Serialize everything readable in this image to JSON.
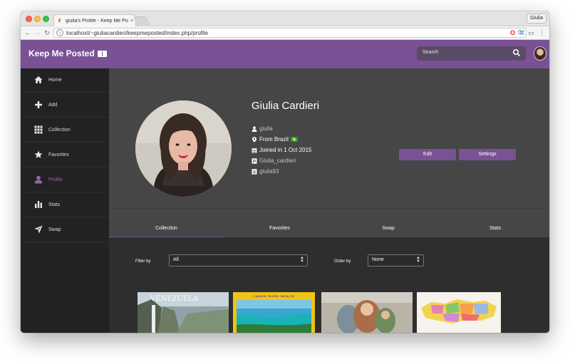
{
  "browser": {
    "tab_title": "giulia's Profile - Keep Me Posted",
    "tab_close": "×",
    "profile_chip": "Giulia",
    "url": "localhost/~giuliacardieri/keepmeposted/index.php/profile"
  },
  "app": {
    "brand": "Keep Me Posted",
    "search_placeholder": "Search",
    "accent_color": "#7a5195"
  },
  "sidebar": {
    "items": [
      {
        "label": "Home",
        "icon": "home-icon"
      },
      {
        "label": "Add",
        "icon": "plus-icon"
      },
      {
        "label": "Collection",
        "icon": "grid-icon"
      },
      {
        "label": "Favorites",
        "icon": "star-icon"
      },
      {
        "label": "Profile",
        "icon": "user-icon",
        "active": true
      },
      {
        "label": "Stats",
        "icon": "bar-chart-icon"
      },
      {
        "label": "Swap",
        "icon": "send-icon"
      }
    ]
  },
  "profile": {
    "name": "Giulia Cardieri",
    "username": "giulia",
    "location": "From Brazil",
    "joined": "Joined in 1 Oct 2015",
    "postcrossing": "Giulia_cardieri",
    "swap_handle": "giulia93",
    "edit_label": "Edit",
    "settings_label": "Settings"
  },
  "tabs": [
    {
      "label": "Collection",
      "active": true
    },
    {
      "label": "Favorites"
    },
    {
      "label": "Swap"
    },
    {
      "label": "Stats"
    }
  ],
  "filters": {
    "filter_label": "Filter by",
    "filter_value": "All",
    "order_label": "Order by",
    "order_value": "None"
  },
  "postcards": [
    {
      "caption": "VENEZUELA",
      "icon": "postcard-venezuela"
    },
    {
      "caption": "JAMAN BURU BEACH",
      "icon": "postcard-beach"
    },
    {
      "caption": "",
      "icon": "postcard-dolls"
    },
    {
      "caption": "",
      "icon": "postcard-map"
    }
  ]
}
